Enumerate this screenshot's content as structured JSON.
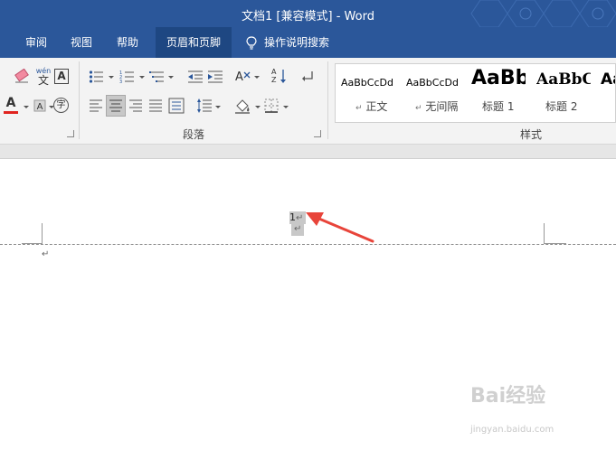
{
  "window": {
    "title": "文档1 [兼容模式]  -  Word"
  },
  "tabs": [
    {
      "label": "审阅",
      "active": false
    },
    {
      "label": "视图",
      "active": false
    },
    {
      "label": "帮助",
      "active": false
    },
    {
      "label": "页眉和页脚",
      "active": true
    }
  ],
  "tellme": {
    "label": "操作说明搜索",
    "icon": "lightbulb-icon"
  },
  "ribbon": {
    "font_group": {
      "icons": [
        "clear-format-icon",
        "phonetic-guide-icon",
        "character-border-icon",
        "font-color-icon",
        "highlight-icon",
        "enclose-characters-icon"
      ],
      "phonetic_text_top": "wén",
      "phonetic_text_bottom": "文",
      "border_letter": "A",
      "font_color_letter": "A",
      "enclose_char": "字",
      "font_color": "#e0231e"
    },
    "paragraph_group": {
      "label": "段落",
      "icons": [
        "bullets-icon",
        "numbering-icon",
        "multilevel-list-icon",
        "decrease-indent-icon",
        "increase-indent-icon",
        "chinese-layout-icon",
        "sort-icon",
        "show-marks-icon",
        "align-left-icon",
        "align-center-icon",
        "align-right-icon",
        "justify-icon",
        "distributed-icon",
        "line-spacing-icon",
        "shading-icon",
        "borders-icon"
      ],
      "sort_label_top": "A",
      "sort_label_bottom": "Z",
      "active_alignment": "center"
    },
    "styles_group": {
      "label": "样式",
      "items": [
        {
          "sample": "AaBbCcDd",
          "name": "正文",
          "marker": "↵"
        },
        {
          "sample": "AaBbCcDd",
          "name": "无间隔",
          "marker": "↵"
        },
        {
          "sample": "AaBb",
          "name": "标题 1",
          "marker": ""
        },
        {
          "sample": "AaBbC",
          "name": "标题 2",
          "marker": ""
        },
        {
          "sample": "Aa",
          "name": "",
          "marker": ""
        }
      ]
    }
  },
  "document": {
    "header_page_number": "1",
    "paragraph_mark": "↵",
    "arrow_color": "#e8443a"
  },
  "watermark": {
    "brand": "Bai经验",
    "url": "jingyan.baidu.com"
  }
}
